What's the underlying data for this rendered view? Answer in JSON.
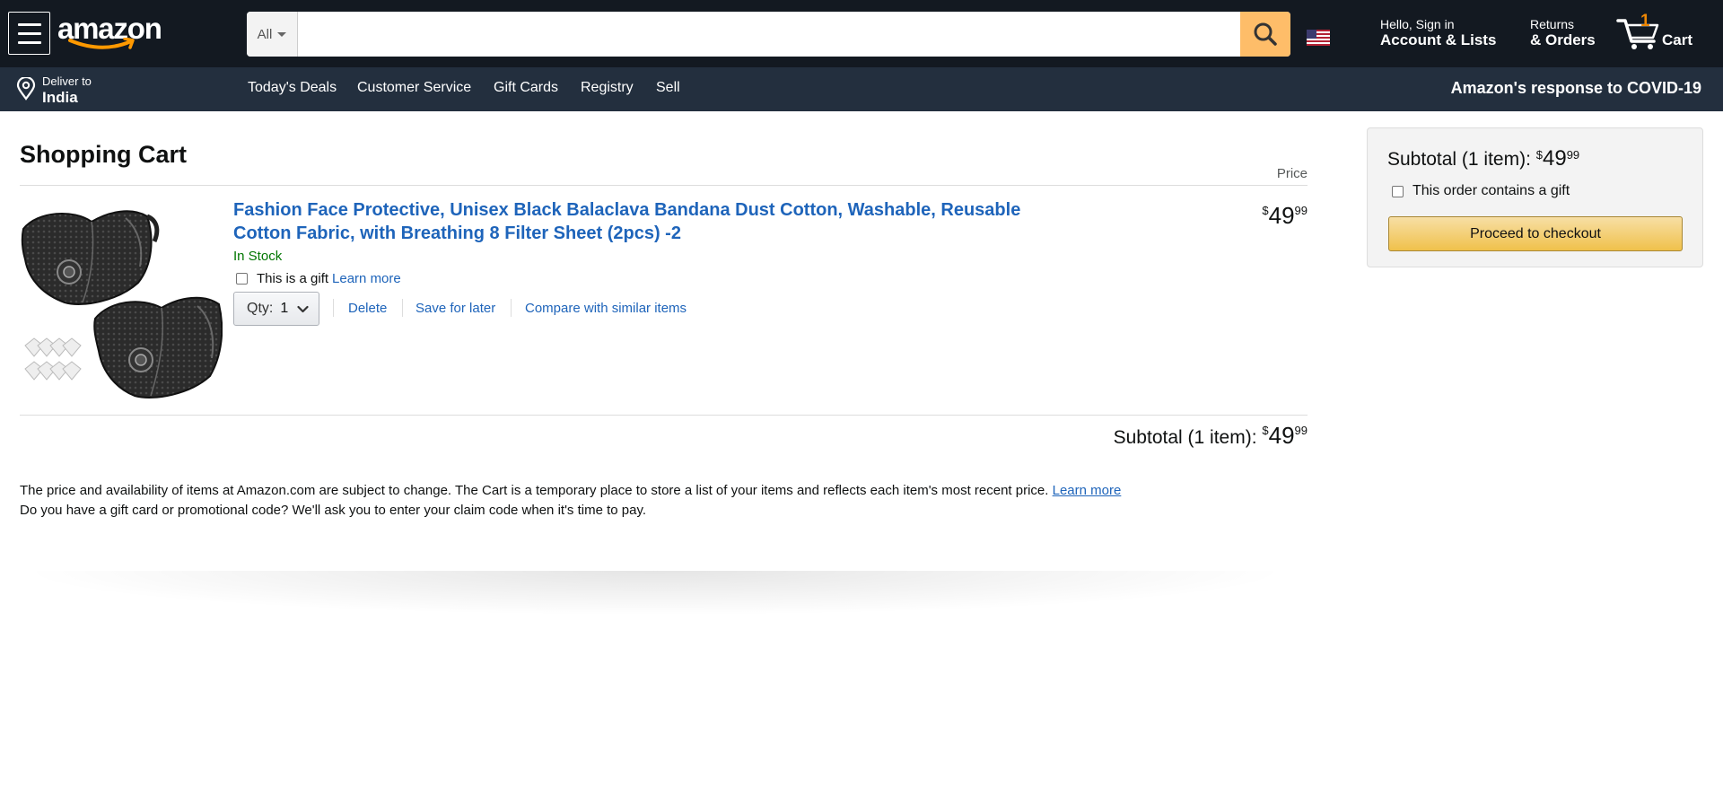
{
  "header": {
    "logo": "amazon",
    "search": {
      "category": "All",
      "placeholder": "",
      "value": ""
    },
    "flag_icon": "us-flag-icon",
    "account": {
      "line1": "Hello, Sign in",
      "line2": "Account & Lists"
    },
    "returns": {
      "line1": "Returns",
      "line2": "& Orders"
    },
    "cart": {
      "count": "1",
      "label": "Cart"
    }
  },
  "subnav": {
    "deliver": {
      "line1": "Deliver to",
      "line2": "India"
    },
    "links": [
      "Today's Deals",
      "Customer Service",
      "Gift Cards",
      "Registry",
      "Sell"
    ],
    "covid": "Amazon's response to COVID-19"
  },
  "cart": {
    "title": "Shopping Cart",
    "price_header": "Price",
    "item": {
      "title": "Fashion Face Protective, Unisex Black Balaclava Bandana Dust Cotton, Washable, Reusable Cotton Fabric, with Breathing 8 Filter Sheet (2pcs) -2",
      "stock": "In Stock",
      "gift_label": "This is a gift",
      "gift_link": "Learn more",
      "qty_label": "Qty:",
      "qty_value": "1",
      "delete": "Delete",
      "save_for_later": "Save for later",
      "compare": "Compare with similar items",
      "price": {
        "symbol": "$",
        "whole": "49",
        "fraction": "99"
      }
    },
    "subtotal": {
      "label": "Subtotal (1 item):",
      "symbol": "$",
      "whole": "49",
      "fraction": "99"
    },
    "disclaimer_line1": "The price and availability of items at Amazon.com are subject to change. The Cart is a temporary place to store a list of your items and reflects each item's most recent price.",
    "disclaimer_link": "Learn more",
    "disclaimer_line2": "Do you have a gift card or promotional code? We'll ask you to enter your claim code when it's time to pay."
  },
  "checkout_panel": {
    "subtotal_label": "Subtotal (1 item):",
    "symbol": "$",
    "whole": "49",
    "fraction": "99",
    "gift_label": "This order contains a gift",
    "button": "Proceed to checkout"
  },
  "colors": {
    "nav_bg": "#131921",
    "subnav_bg": "#232f3e",
    "search_button": "#febd69",
    "link": "#1e64ba",
    "in_stock": "#007600",
    "cart_count": "#f08804",
    "checkout_button": "#f0c14b"
  }
}
